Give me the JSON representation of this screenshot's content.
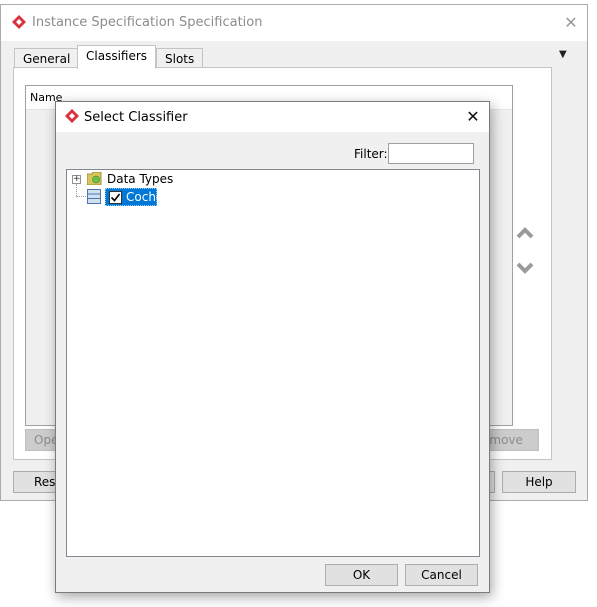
{
  "main_window": {
    "title": "Instance Specification Specification",
    "tabs": [
      "General",
      "Classifiers",
      "Slots"
    ],
    "active_tab": "Classifiers",
    "table_header": "Name",
    "buttons": {
      "open": "Ope",
      "remove": "emove",
      "reset": "Rese",
      "help": "Help"
    }
  },
  "dialog": {
    "title": "Select Classifier",
    "filter_label": "Filter:",
    "filter_value": "",
    "tree": [
      {
        "label": "Data Types",
        "icon": "package-folder-icon"
      },
      {
        "label": "Coche",
        "icon": "class-icon",
        "checked": true,
        "selected": true
      }
    ],
    "ok_label": "OK",
    "cancel_label": "Cancel"
  },
  "colors": {
    "selection": "#0078d7",
    "window_bg": "#f0f0f0",
    "app_icon": "#d8323c"
  },
  "icons": {
    "app": "visual-paradigm-icon",
    "close": "close-icon",
    "move_up": "chevron-up-icon",
    "move_down": "chevron-down-icon"
  }
}
